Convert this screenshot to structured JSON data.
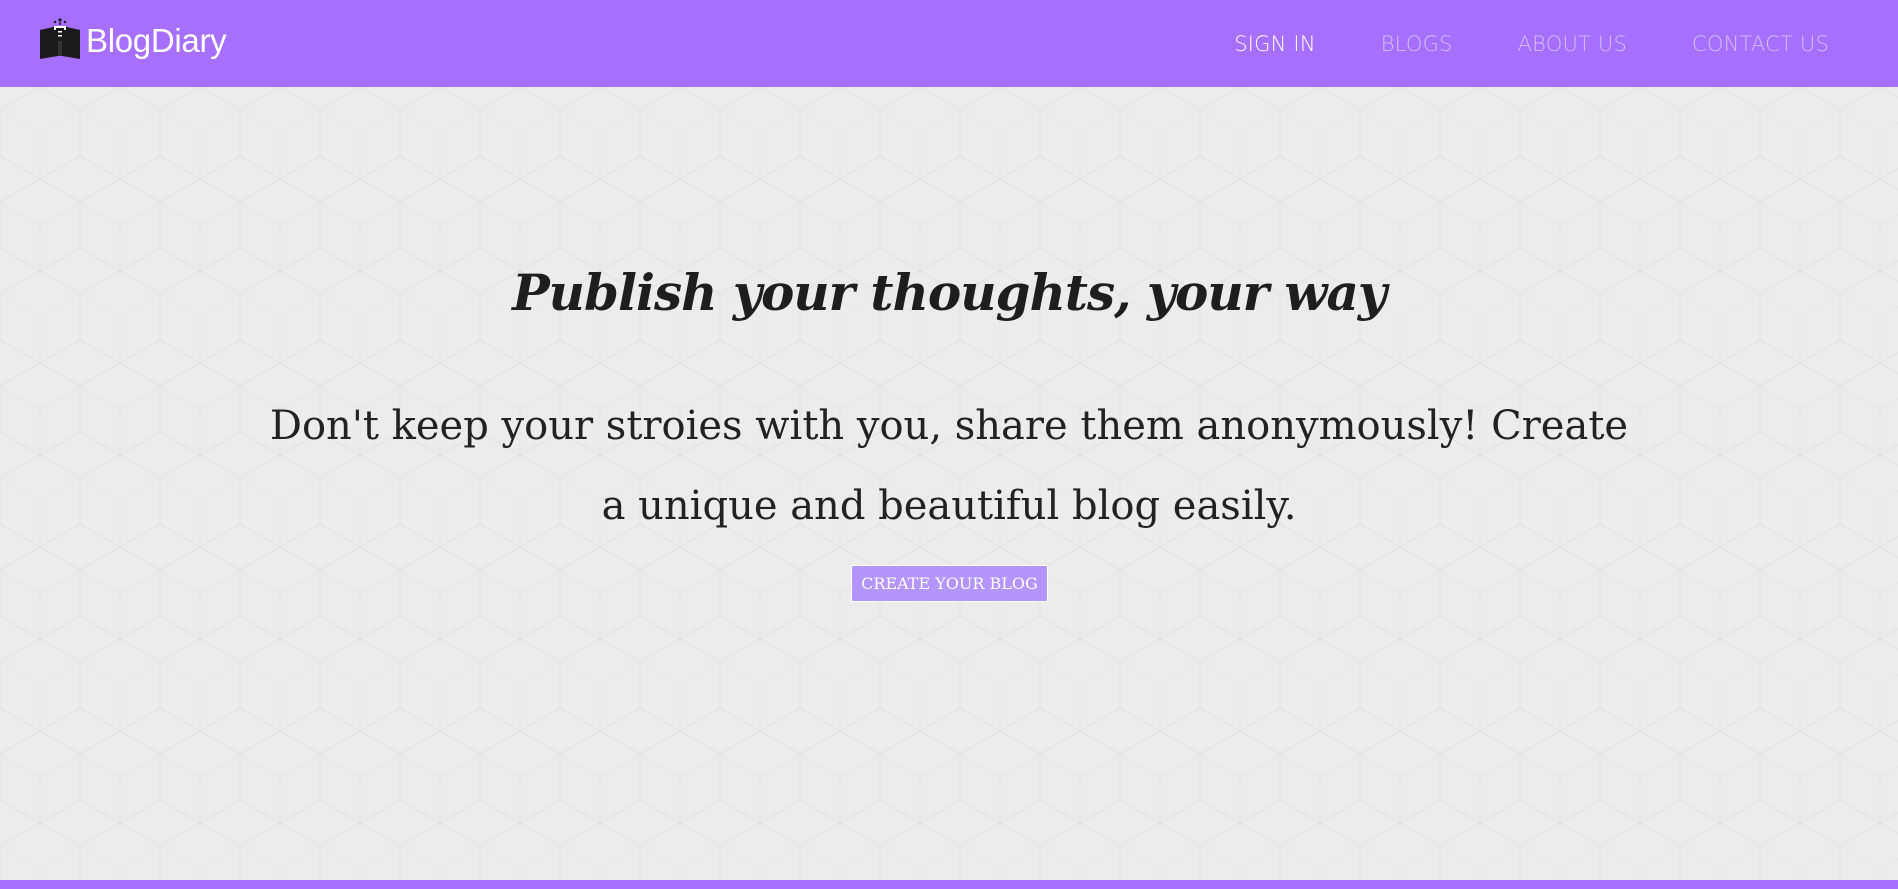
{
  "brand": {
    "name": "BlogDiary",
    "icon": "blog-diary-logo-icon"
  },
  "nav": {
    "items": [
      {
        "label": "SIGN IN",
        "active": true
      },
      {
        "label": "BLOGS",
        "active": false
      },
      {
        "label": "ABOUT US",
        "active": false
      },
      {
        "label": "CONTACT US",
        "active": false
      }
    ]
  },
  "hero": {
    "title": "Publish your thoughts, your way",
    "subtitle": "Don't keep your stroies with you, share them anonymously! Create a unique and beautiful blog easily.",
    "cta_label": "CREATE YOUR BLOG"
  },
  "colors": {
    "brand": "#a66ffd",
    "background": "#ececec",
    "button": "#b395fb",
    "nav_inactive": "#d2c0f8",
    "text": "#222222"
  }
}
